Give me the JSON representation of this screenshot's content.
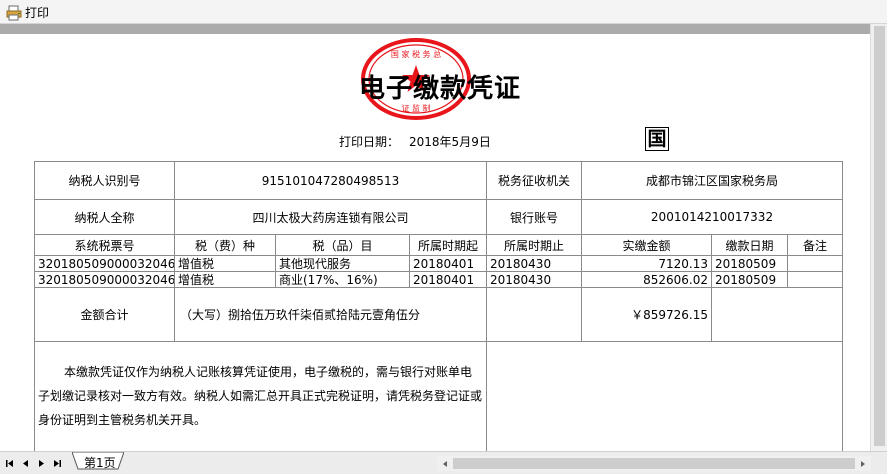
{
  "toolbar": {
    "print_label": "打印"
  },
  "voucher": {
    "title": "电子缴款凭证",
    "stamp_text_top": "国 家 税 务 总",
    "stamp_text_bottom": "证 监 制",
    "print_date_label": "打印日期：",
    "print_date_value": "2018年5月9日",
    "guo_char": "国",
    "taxpayer_id_label": "纳税人识别号",
    "taxpayer_id": "915101047280498513",
    "tax_authority_label": "税务征收机关",
    "tax_authority": "成都市锦江区国家税务局",
    "taxpayer_name_label": "纳税人全称",
    "taxpayer_name": "四川太极大药房连锁有限公司",
    "bank_account_label": "银行账号",
    "bank_account": "2001014210017332",
    "columns": [
      "系统税票号",
      "税（费）种",
      "税（品）目",
      "所属时期起",
      "所属时期止",
      "实缴金额",
      "缴款日期",
      "备注"
    ],
    "rows": [
      [
        "320180509000032046",
        "增值税",
        "其他现代服务",
        "20180401",
        "20180430",
        "7120.13",
        "20180509",
        ""
      ],
      [
        "320180509000032046",
        "增值税",
        "商业(17%、16%)",
        "20180401",
        "20180430",
        "852606.02",
        "20180509",
        ""
      ]
    ],
    "total_label": "金额合计",
    "total_words": "（大写）捌拾伍万玖仟柒佰贰拾陆元壹角伍分",
    "total_amount": "￥859726.15",
    "notice": "本缴款凭证仅作为纳税人记账核算凭证使用，电子缴税的，需与银行对账单电子划缴记录核对一致方有效。纳税人如需汇总开具正式完税证明，请凭税务登记证或身份证明到主管税务机关开具。"
  },
  "statusbar": {
    "sheet_tab": "第1页"
  },
  "colors": {
    "stamp_red": "#e8151b",
    "grid_line": "#8a8a8a",
    "viewport_bg": "#ababab"
  }
}
